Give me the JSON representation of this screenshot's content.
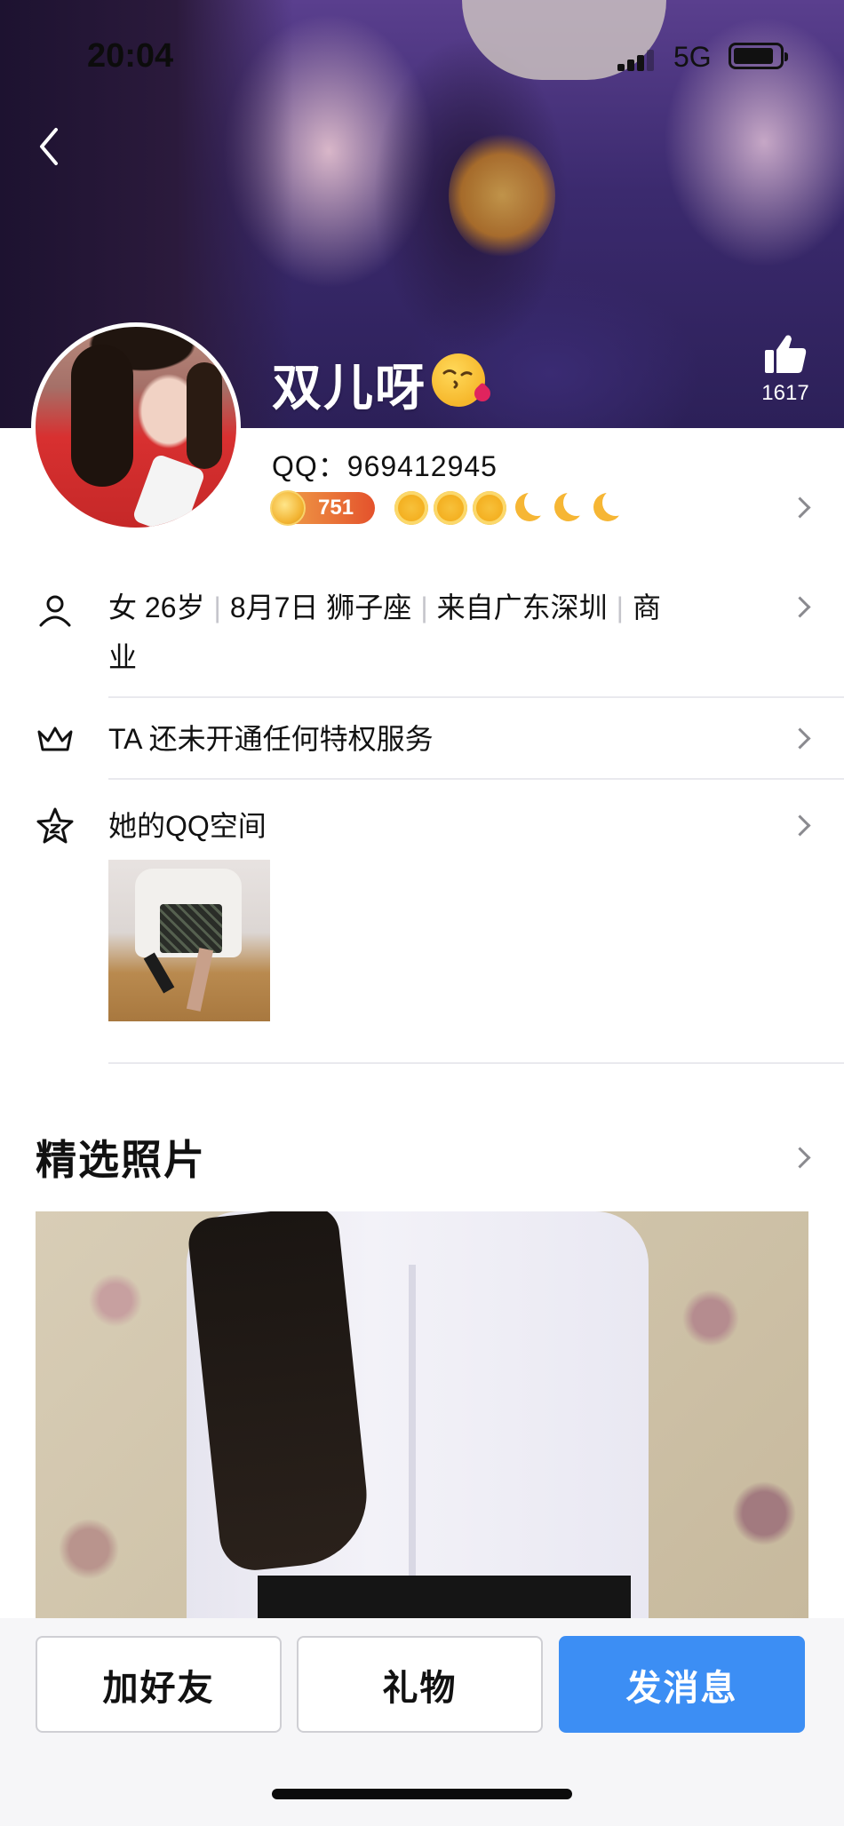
{
  "status_bar": {
    "time": "20:04",
    "network": "5G"
  },
  "profile": {
    "name": "双儿呀",
    "likes_count": "1617",
    "qq_line": "QQ：969412945",
    "vip_level": "751",
    "level_icons": [
      "sun",
      "sun",
      "sun",
      "moon",
      "moon",
      "moon"
    ]
  },
  "info": {
    "basic": "女 26岁",
    "birthday": "8月7日 狮子座",
    "location": "来自广东深圳",
    "job_1": "商",
    "job_2": "业",
    "privilege": "TA 还未开通任何特权服务",
    "qzone": "她的QQ空间"
  },
  "featured": {
    "title": "精选照片"
  },
  "actions": {
    "add_friend": "加好友",
    "gift": "礼物",
    "message": "发消息"
  },
  "colors": {
    "primary": "#3c8ef4",
    "cover": "#4a3581"
  }
}
